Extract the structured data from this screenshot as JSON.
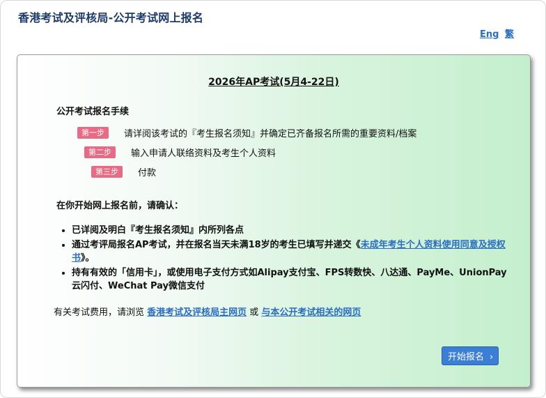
{
  "header": {
    "site_title": "香港考试及评核局-公开考试网上报名",
    "lang_eng": "Eng",
    "lang_trad": "繁"
  },
  "panel": {
    "exam_title": "2026年AP考试(5月4-22日)",
    "procedure_heading": "公开考试报名手续",
    "steps": [
      {
        "badge": "第一步",
        "text": "请详阅该考试的『考生报名须知』并确定已齐备报名所需的重要资料/档案"
      },
      {
        "badge": "第二步",
        "text": "输入申请人联络资料及考生个人资料"
      },
      {
        "badge": "第三步",
        "text": "付款"
      }
    ],
    "confirm_heading": "在你开始网上报名前，请确认：",
    "confirm_items": {
      "item1": "已详阅及明白『考生报名须知』内所列各点",
      "item2_before": "通过考评局报名AP考试，并在报名当天未满18岁的考生已填写并递交《",
      "item2_link": "未成年考生个人资料使用同意及授权书",
      "item2_after": "》。",
      "item3": "持有有效的「信用卡」，或使用电子支付方式如Alipay支付宝、FPS转数快、八达通、PayMe、UnionPay 云闪付、WeChat Pay微信支付"
    },
    "fees": {
      "prefix": "有关考试费用，请浏览 ",
      "link1": "香港考试及评核局主网页",
      "middle": " 或 ",
      "link2": "与本公开考试相关的网页"
    },
    "start_button": "开始报名",
    "start_button_icon": "›"
  }
}
